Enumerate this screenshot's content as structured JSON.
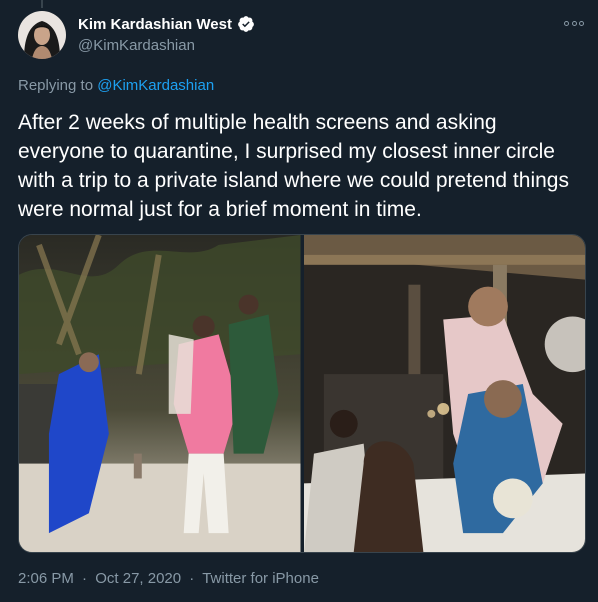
{
  "tweet": {
    "author_name": "Kim Kardashian West",
    "author_handle": "@KimKardashian",
    "replying_label": "Replying to",
    "replying_to": "@KimKardashian",
    "text": "After 2 weeks of multiple health screens and asking everyone to quarantine, I surprised my closest inner circle with a trip to a private island where we could pretend things were normal just for a brief moment in time.",
    "time": "2:06 PM",
    "date": "Oct 27, 2020",
    "source": "Twitter for iPhone",
    "separator": "·"
  },
  "colors": {
    "background": "#15202b",
    "secondary_text": "#8899a6",
    "link": "#1da1f2",
    "verified": "#ffffff"
  },
  "icons": {
    "verified": "verified-badge-icon",
    "more": "more-options-icon"
  }
}
